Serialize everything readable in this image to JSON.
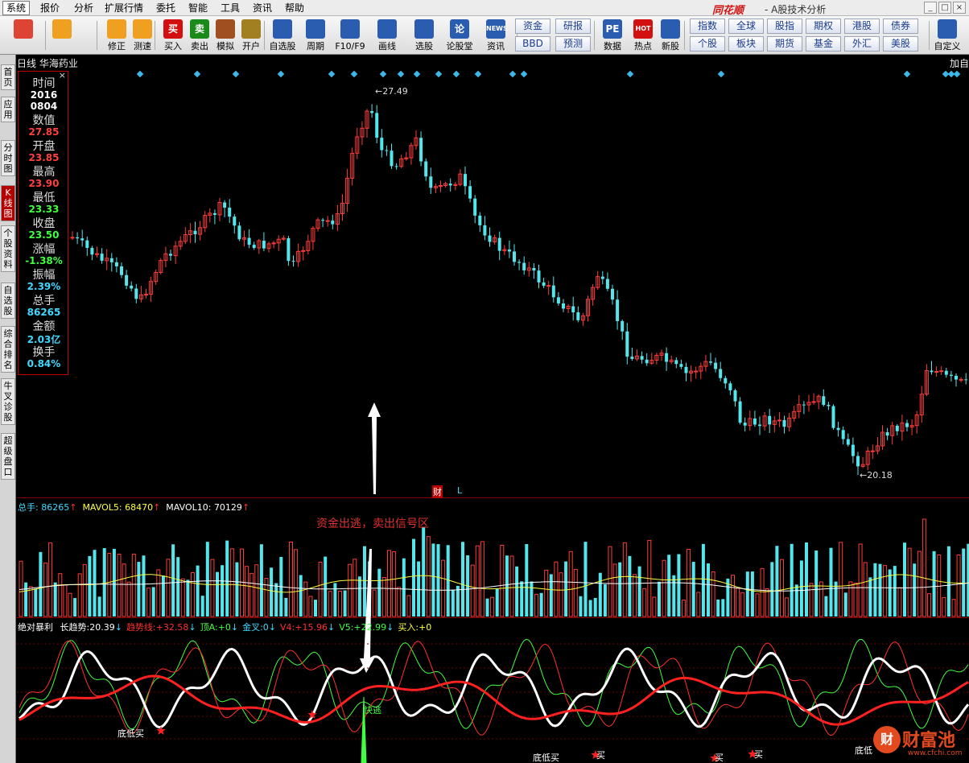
{
  "menu": {
    "items": [
      "系统",
      "报价",
      "分析",
      "扩展行情",
      "委托",
      "智能",
      "工具",
      "资讯",
      "帮助"
    ],
    "brand": "同花顺",
    "subtitle": "- A股技术分析"
  },
  "toolbar": {
    "buttons": [
      {
        "label": "",
        "icon": "grid-icon",
        "color": "#d43"
      },
      {
        "label": "",
        "icon": "back-arrow-icon",
        "color": "#f0a020"
      },
      {
        "label": "修正",
        "icon": "refresh-icon",
        "color": "#f0a020"
      },
      {
        "label": "测速",
        "icon": "clock-icon",
        "color": "#f0a020"
      },
      {
        "label": "买入",
        "icon": "buy-icon",
        "glyph": "买",
        "color": "#d21010"
      },
      {
        "label": "卖出",
        "icon": "sell-icon",
        "glyph": "卖",
        "color": "#1a8a1a"
      },
      {
        "label": "模拟",
        "icon": "hammer-icon",
        "color": "#a05020"
      },
      {
        "label": "开户",
        "icon": "lock-icon",
        "color": "#a08020"
      },
      {
        "label": "自选股",
        "icon": "star-icon",
        "color": "#2a5db0"
      },
      {
        "label": "周期",
        "icon": "cycle-icon",
        "color": "#2a5db0"
      },
      {
        "label": "F10/F9",
        "icon": "f10-icon",
        "color": "#2a5db0"
      },
      {
        "label": "画线",
        "icon": "pen-icon",
        "color": "#2a5db0"
      },
      {
        "label": "选股",
        "icon": "screen-icon",
        "color": "#2a5db0"
      },
      {
        "label": "论股堂",
        "icon": "forum-icon",
        "glyph": "论",
        "color": "#2a5db0"
      },
      {
        "label": "资讯",
        "icon": "news-icon",
        "glyph": "NEWS",
        "color": "#2a5db0"
      },
      {
        "label": "数据",
        "icon": "pe-icon",
        "glyph": "PE",
        "color": "#2a5db0"
      },
      {
        "label": "热点",
        "icon": "hot-icon",
        "glyph": "HOT",
        "color": "#d21010"
      },
      {
        "label": "新股",
        "icon": "newstock-icon",
        "color": "#2a5db0"
      },
      {
        "label": "自定义",
        "icon": "custom-icon",
        "color": "#2a5db0"
      }
    ],
    "grid1": [
      "资金",
      "研报",
      "BBD",
      "预测"
    ],
    "grid2": [
      "指数",
      "全球",
      "股指",
      "期权",
      "港股",
      "债券",
      "个股",
      "板块",
      "期货",
      "基金",
      "外汇",
      "美股"
    ]
  },
  "sidebar": {
    "tabs": [
      "首页",
      "应用",
      "分时图",
      "K线图",
      "个股资料",
      "自选股",
      "综合排名",
      "牛叉诊股",
      "超级盘口"
    ],
    "active": 3
  },
  "chart": {
    "header": "日线  华海药业",
    "right_label": "加自",
    "high_label": "27.49",
    "low_label": "20.18",
    "cai_label": "财",
    "l_label": "L"
  },
  "info": {
    "rows": [
      {
        "label": "时间",
        "value": "2016",
        "value2": "0804",
        "color": "#ffffff"
      },
      {
        "label": "数值",
        "value": "27.85",
        "color": "#ff4040"
      },
      {
        "label": "开盘",
        "value": "23.85",
        "color": "#ff4040"
      },
      {
        "label": "最高",
        "value": "23.90",
        "color": "#ff4040"
      },
      {
        "label": "最低",
        "value": "23.33",
        "color": "#40ff40"
      },
      {
        "label": "收盘",
        "value": "23.50",
        "color": "#40ff40"
      },
      {
        "label": "涨幅",
        "value": "-1.38%",
        "color": "#40ff40"
      },
      {
        "label": "振幅",
        "value": "2.39%",
        "color": "#40d8ff"
      },
      {
        "label": "总手",
        "value": "86265",
        "color": "#40d8ff"
      },
      {
        "label": "金额",
        "value": "2.03亿",
        "color": "#40d8ff"
      },
      {
        "label": "换手",
        "value": "0.84%",
        "color": "#40d8ff"
      }
    ]
  },
  "volume": {
    "label": "总手:",
    "value": "86265",
    "ma5_label": "MAVOL5:",
    "ma5": "68470",
    "ma10_label": "MAVOL10:",
    "ma10": "70129",
    "annotation": "资金出逃，卖出信号区"
  },
  "indicator": {
    "name": "绝对暴利",
    "items": [
      {
        "label": "长趋势:",
        "value": "20.39",
        "arrow": "↓",
        "color": "#ffffff"
      },
      {
        "label": "趋势线:",
        "value": "+32.58",
        "arrow": "↓",
        "color": "#ff3030"
      },
      {
        "label": "顶A:",
        "value": "+0",
        "arrow": "↓",
        "color": "#40ff40"
      },
      {
        "label": "金叉:",
        "value": "0",
        "arrow": "↓",
        "color": "#40d8ff"
      },
      {
        "label": "V4:",
        "value": "+15.96",
        "arrow": "↓",
        "color": "#ff3030"
      },
      {
        "label": "V5:",
        "value": "+22.99",
        "arrow": "↓",
        "color": "#40ff40"
      },
      {
        "label": "买入:",
        "value": "+0",
        "arrow": "",
        "color": "#ffff40"
      }
    ],
    "labels": {
      "dibu1": "底低买",
      "kuaitao": "快逃",
      "dibu2": "底低买",
      "mai1": "买",
      "mai2": "买",
      "mai3": "买",
      "dibu3": "底低"
    }
  },
  "watermark": {
    "logo": "财",
    "text": "财富池",
    "url": "www.cfchi.com"
  },
  "colors": {
    "up": "#ff3c3c",
    "down": "#54e6ec",
    "grid": "#8b0000"
  }
}
